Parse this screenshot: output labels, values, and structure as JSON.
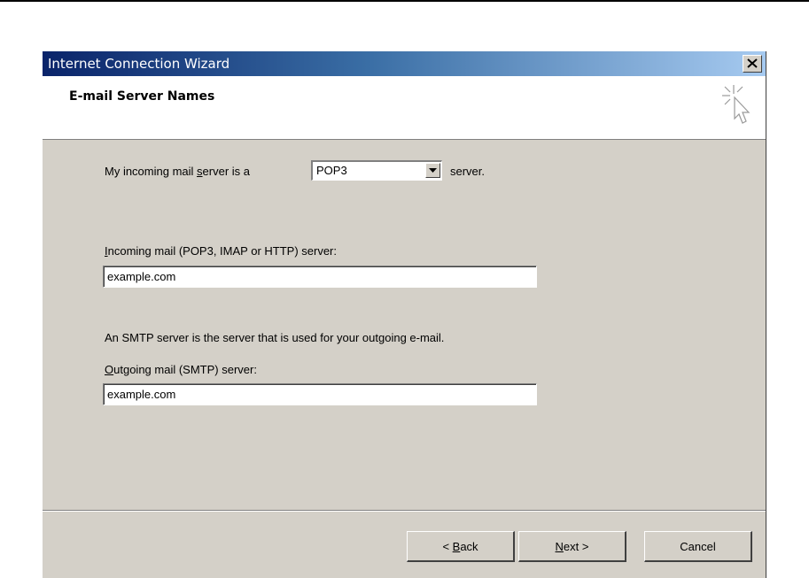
{
  "window": {
    "title": "Internet Connection Wizard",
    "close_glyph": "×"
  },
  "header": {
    "heading": "E-mail Server Names",
    "icon": "wizard-cursor-icon"
  },
  "form": {
    "incoming_type_prefix": "My incoming mail ",
    "incoming_type_accel": "s",
    "incoming_type_suffix": "erver is a",
    "server_type_value": "POP3",
    "server_word": "server.",
    "incoming_label_accel": "I",
    "incoming_label_rest": "ncoming mail (POP3, IMAP or HTTP) server:",
    "incoming_value": "example.com",
    "smtp_note": "An SMTP server is the server that is used for your outgoing e-mail.",
    "outgoing_label_accel": "O",
    "outgoing_label_rest": "utgoing mail (SMTP) server:",
    "outgoing_value": "example.com"
  },
  "buttons": {
    "back_prefix": "< ",
    "back_accel": "B",
    "back_rest": "ack",
    "next_accel": "N",
    "next_rest": "ext >",
    "cancel": "Cancel"
  },
  "colors": {
    "dialog_face": "#d4d0c8",
    "title_start": "#0a246a",
    "title_end": "#a6caf0"
  }
}
